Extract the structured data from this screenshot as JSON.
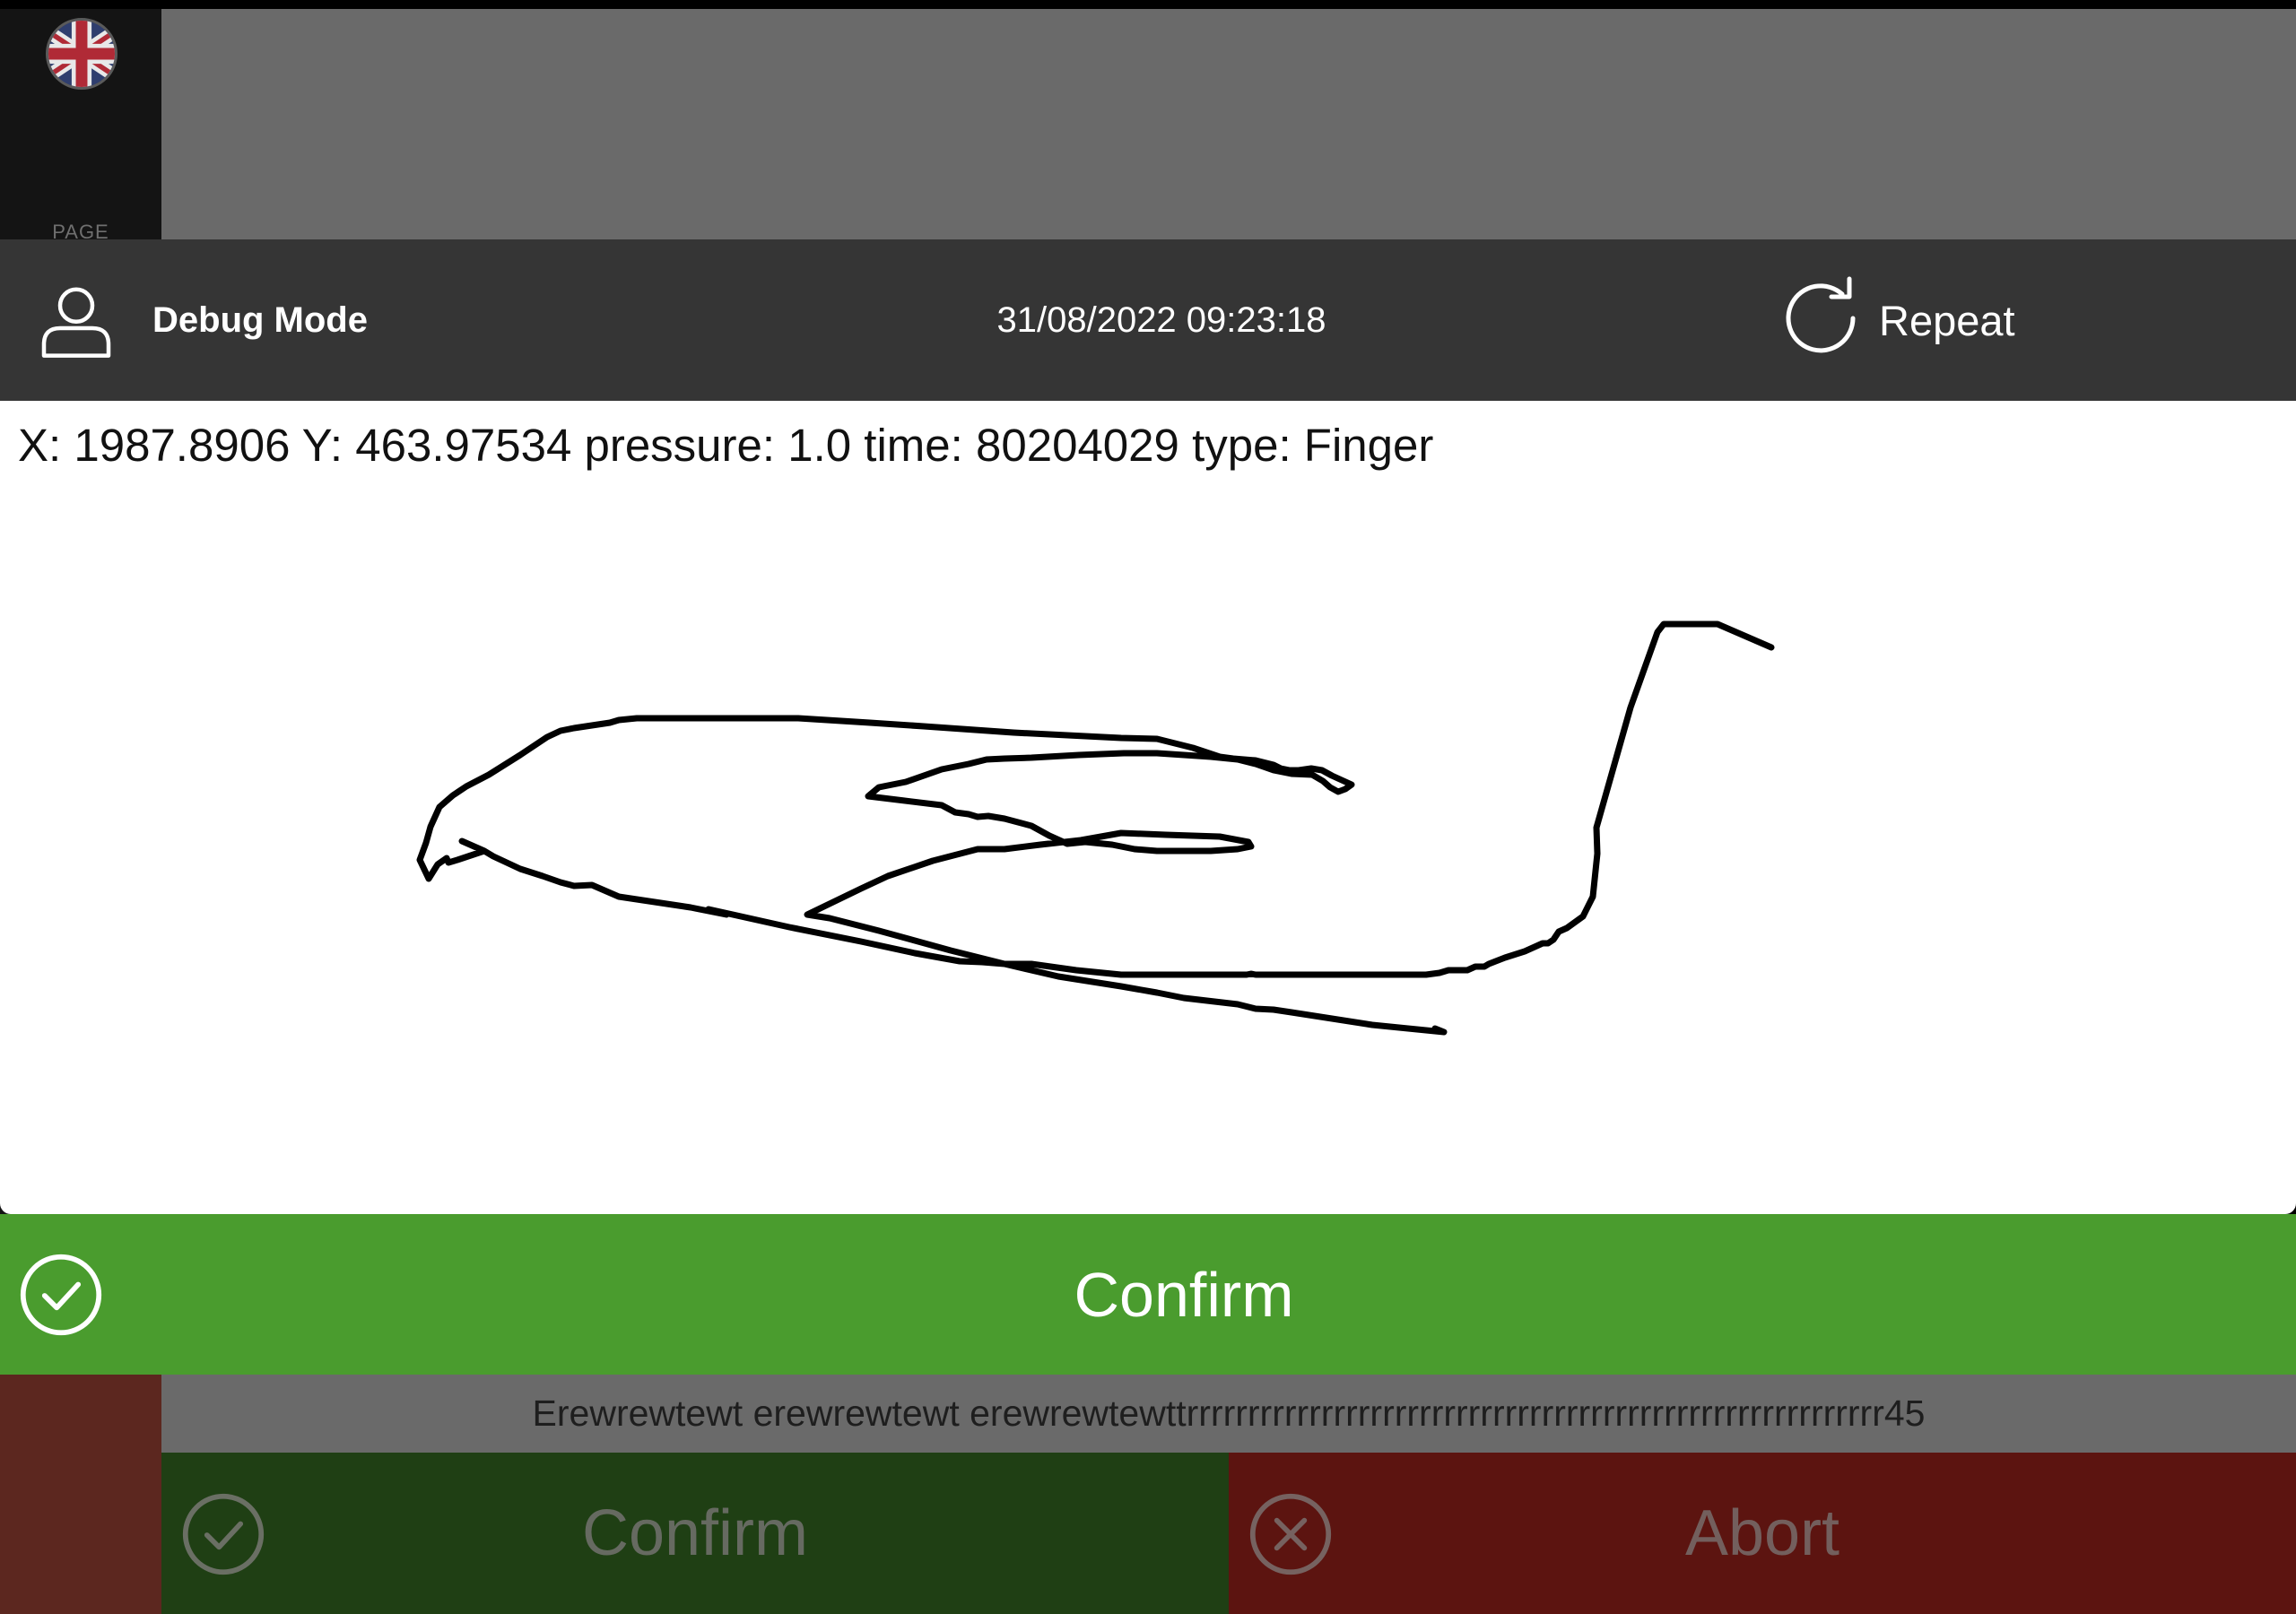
{
  "background_app": {
    "page_label": "PAGE",
    "message": "Erewrewtewt erewrewtewt erewrewtewttrrrrrrrrrrrrrrrrrrrrrrrrrrrrrrrrrrrrrrrrrrrrrrrrrrrrrrrrr45",
    "confirm_label": "Confirm",
    "abort_label": "Abort",
    "language_icon": "uk-flag-icon"
  },
  "dialog": {
    "user_name": "Debug Mode",
    "timestamp": "31/08/2022 09:23:18",
    "repeat_label": "Repeat",
    "debug_readout": "X: 1987.8906 Y: 463.97534 pressure: 1.0  time: 80204029 type: Finger",
    "confirm_label": "Confirm",
    "user_icon": "user-icon",
    "repeat_icon": "refresh-icon",
    "confirm_icon": "check-circle-icon"
  },
  "colors": {
    "confirm_green": "#4a9c2e",
    "header_dark": "#353535",
    "abort_red": "#5c1410"
  }
}
